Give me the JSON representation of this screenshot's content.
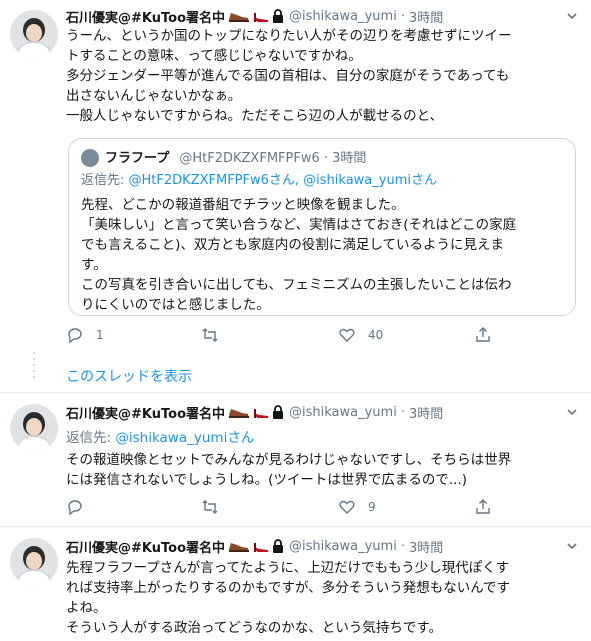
{
  "tweets": [
    {
      "name": "石川優実@#KuToo署名中",
      "handle": "@ishikawa_yumi",
      "time": "3時間",
      "lines": [
        "うーん、というか国のトップになりたい人がその辺りを考慮せずにツイー",
        "トすることの意味、って感じじゃないですかね。",
        "多分ジェンダー平等が進んでる国の首相は、自分の家庭がそうであっても",
        "出さないんじゃないかなぁ。",
        "一般人じゃないですからね。ただそこら辺の人が載せるのと、"
      ],
      "quote": {
        "name": "フラフープ",
        "handle": "@HtF2DKZXFMFPFw6",
        "time": "3時間",
        "reply_prefix": "返信先:",
        "reply_mentions": "@HtF2DKZXFMFPFw6さん, @ishikawa_yumiさん",
        "lines": [
          "先程、どこかの報道番組でチラッと映像を観ました。",
          "「美味しい」と言って笑い合うなど、実情はさておき(それはどこの家庭",
          "でも言えること)、双方とも家庭内の役割に満足しているように見えま",
          "す。",
          "この写真を引き合いに出しても、フェミニズムの主張したいことは伝わ",
          "りにくいのではと感じました。"
        ]
      },
      "reply_count": "1",
      "retweet_count": "",
      "like_count": "40"
    },
    {
      "name": "石川優実@#KuToo署名中",
      "handle": "@ishikawa_yumi",
      "time": "3時間",
      "reply_prefix": "返信先:",
      "reply_mentions": "@ishikawa_yumiさん",
      "lines": [
        "その報道映像とセットでみんなが見るわけじゃないですし、そちらは世界",
        "には発信されないでしょうしね。(ツイートは世界で広まるので...)"
      ],
      "reply_count": "",
      "retweet_count": "",
      "like_count": "9"
    },
    {
      "name": "石川優実@#KuToo署名中",
      "handle": "@ishikawa_yumi",
      "time": "3時間",
      "lines": [
        "先程フラフープさんが言ってたように、上辺だけでももう少し現代ぽくす",
        "れば支持率上がったりするのかもですが、多分そういう発想もないんです",
        "よね。",
        "そういう人がする政治ってどうなのかな、という気持ちです。"
      ]
    }
  ],
  "show_thread_label": "このスレッドを表示",
  "header_emoji": [
    "shoe-icon",
    "heel-icon",
    "lock-icon"
  ],
  "colors": {
    "link": "#1b95e0",
    "muted": "#657786",
    "text": "#14171a",
    "divider": "#e6ecf0",
    "shoe": "#8a4a2a",
    "heel": "#c1121f"
  }
}
